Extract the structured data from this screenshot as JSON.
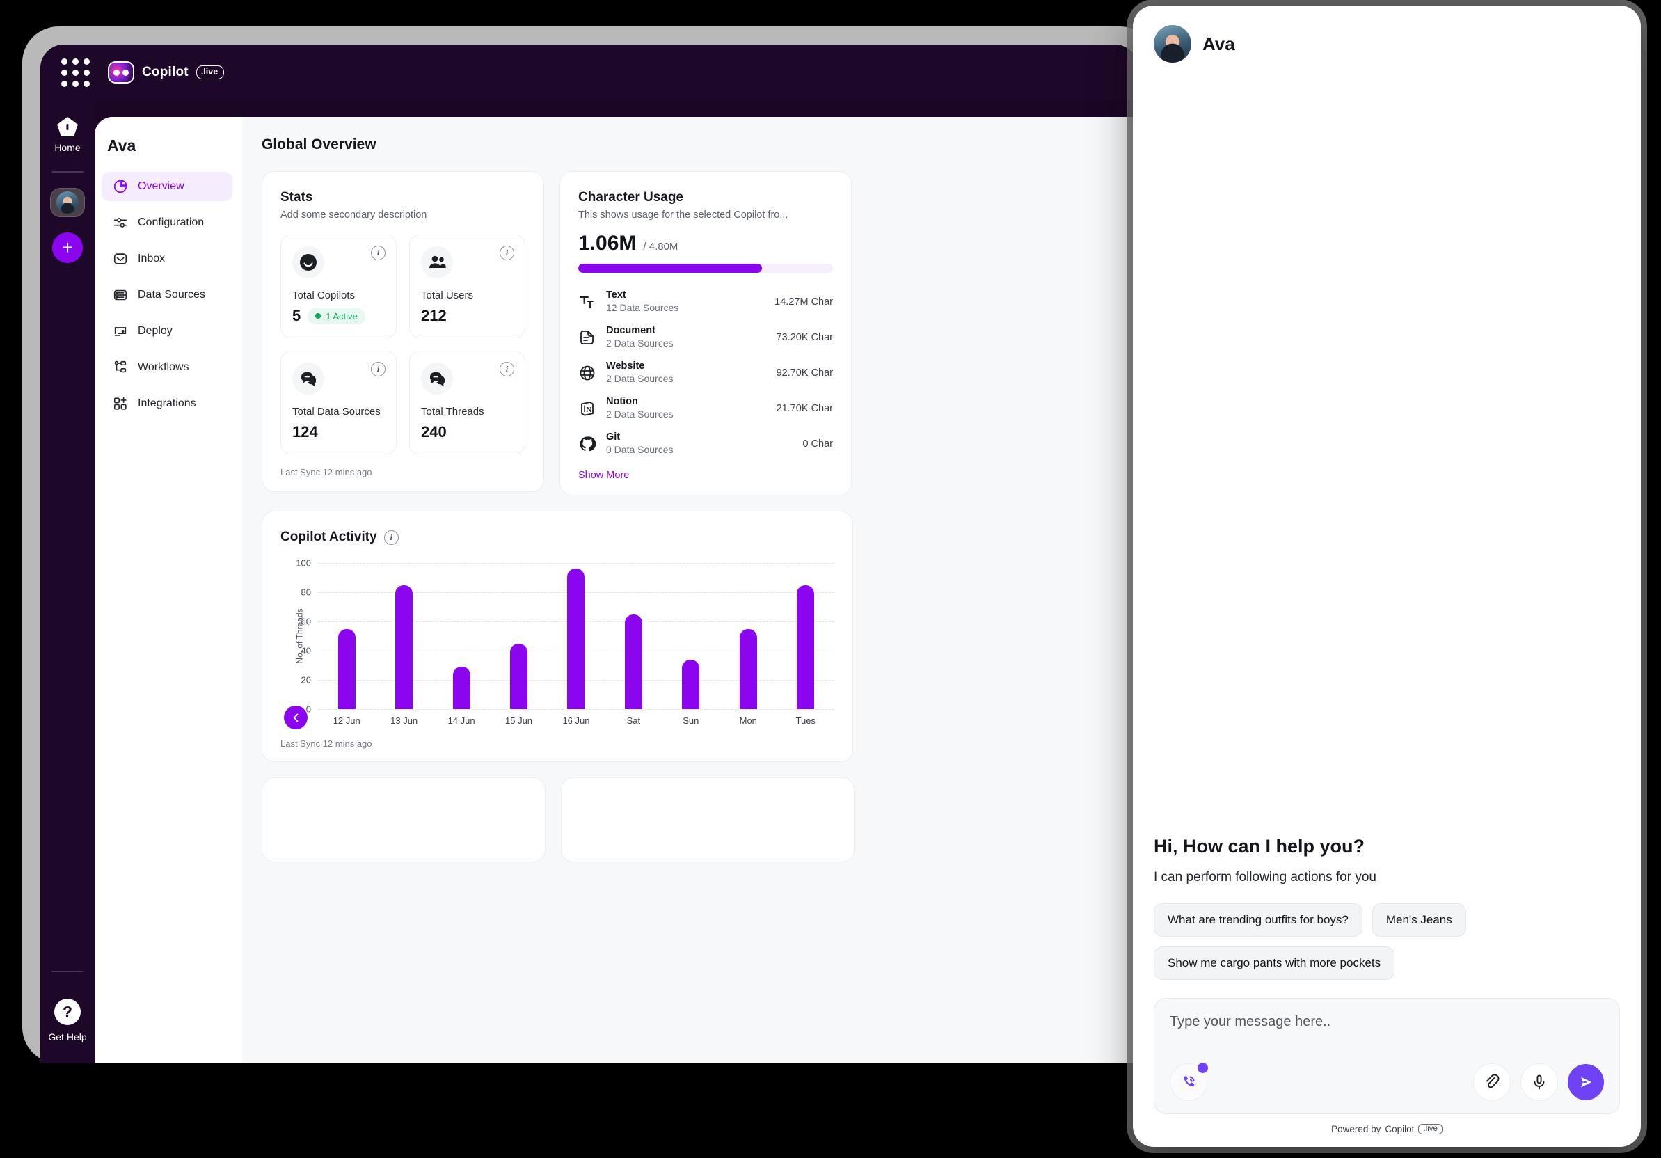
{
  "brand": {
    "name": "Copilot",
    "badge": ".live",
    "logo_icon": "copilot-logo-icon",
    "apps_icon": "apps-grid-icon"
  },
  "rail": {
    "home_label": "Home",
    "home_icon": "home-icon",
    "avatar_icon": "user-avatar",
    "add_label": "+",
    "help_label": "Get Help",
    "help_icon": "question-mark-icon"
  },
  "sidebar": {
    "title": "Ava",
    "items": [
      {
        "label": "Overview",
        "icon": "pie-chart-icon",
        "active": true
      },
      {
        "label": "Configuration",
        "icon": "sliders-icon",
        "active": false
      },
      {
        "label": "Inbox",
        "icon": "inbox-icon",
        "active": false
      },
      {
        "label": "Data Sources",
        "icon": "database-icon",
        "active": false
      },
      {
        "label": "Deploy",
        "icon": "deploy-icon",
        "active": false
      },
      {
        "label": "Workflows",
        "icon": "workflow-icon",
        "active": false
      },
      {
        "label": "Integrations",
        "icon": "integrations-icon",
        "active": false
      }
    ]
  },
  "page": {
    "title": "Global Overview",
    "collapse_icon": "chevron-left-icon"
  },
  "stats": {
    "title": "Stats",
    "subtitle": "Add some secondary description",
    "last_sync": "Last Sync 12 mins ago",
    "info_icon": "info-icon",
    "boxes": [
      {
        "label": "Total Copilots",
        "value": "5",
        "icon": "smiley-face-icon",
        "badge": "1 Active"
      },
      {
        "label": "Total Users",
        "value": "212",
        "icon": "users-icon",
        "badge": ""
      },
      {
        "label": "Total Data Sources",
        "value": "124",
        "icon": "chat-bubbles-icon",
        "badge": ""
      },
      {
        "label": "Total Threads",
        "value": "240",
        "icon": "chat-bubbles-icon",
        "badge": ""
      }
    ]
  },
  "usage": {
    "title": "Character Usage",
    "subtitle": "This shows usage for the selected Copilot fro...",
    "used": "1.06M",
    "total": "/ 4.80M",
    "percent": 72,
    "accent": "#8b06ef",
    "show_more": "Show More",
    "rows": [
      {
        "name": "Text",
        "sources": "12 Data Sources",
        "amount": "14.27M Char",
        "icon": "text-format-icon"
      },
      {
        "name": "Document",
        "sources": "2 Data Sources",
        "amount": "73.20K Char",
        "icon": "document-icon"
      },
      {
        "name": "Website",
        "sources": "2 Data Sources",
        "amount": "92.70K Char",
        "icon": "globe-icon"
      },
      {
        "name": "Notion",
        "sources": "2 Data Sources",
        "amount": "21.70K Char",
        "icon": "notion-icon"
      },
      {
        "name": "Git",
        "sources": "0 Data Sources",
        "amount": "0 Char",
        "icon": "github-icon"
      }
    ]
  },
  "activity": {
    "title": "Copilot Activity",
    "info_icon": "info-icon",
    "last_sync": "Last Sync 12 mins ago"
  },
  "chart_data": {
    "type": "bar",
    "title": "Copilot Activity",
    "xlabel": "",
    "ylabel": "No. of Threads",
    "ylim": [
      0,
      100
    ],
    "yticks": [
      0,
      20,
      40,
      60,
      80,
      100
    ],
    "grid": true,
    "legend": "none",
    "bar_color": "#8b06ef",
    "categories": [
      "12 Jun",
      "13 Jun",
      "14 Jun",
      "15 Jun",
      "16 Jun",
      "Sat",
      "Sun",
      "Mon",
      "Tues"
    ],
    "values": [
      55,
      85,
      29,
      45,
      96,
      65,
      34,
      55,
      85
    ]
  },
  "chat": {
    "title": "Ava",
    "avatar_icon": "chat-avatar",
    "greeting": "Hi, How can I help you?",
    "subtitle": "I can perform following actions for you",
    "suggestions": [
      "What are trending outfits for boys?",
      "Men's Jeans",
      "Show me cargo pants with more pockets"
    ],
    "composer": {
      "placeholder": "Type your message here..",
      "value": "",
      "call_icon": "phone-call-icon",
      "attach_icon": "paperclip-icon",
      "mic_icon": "microphone-icon",
      "send_icon": "send-icon"
    },
    "footer_prefix": "Powered by",
    "footer_brand": "Copilot",
    "footer_badge": ".live"
  }
}
